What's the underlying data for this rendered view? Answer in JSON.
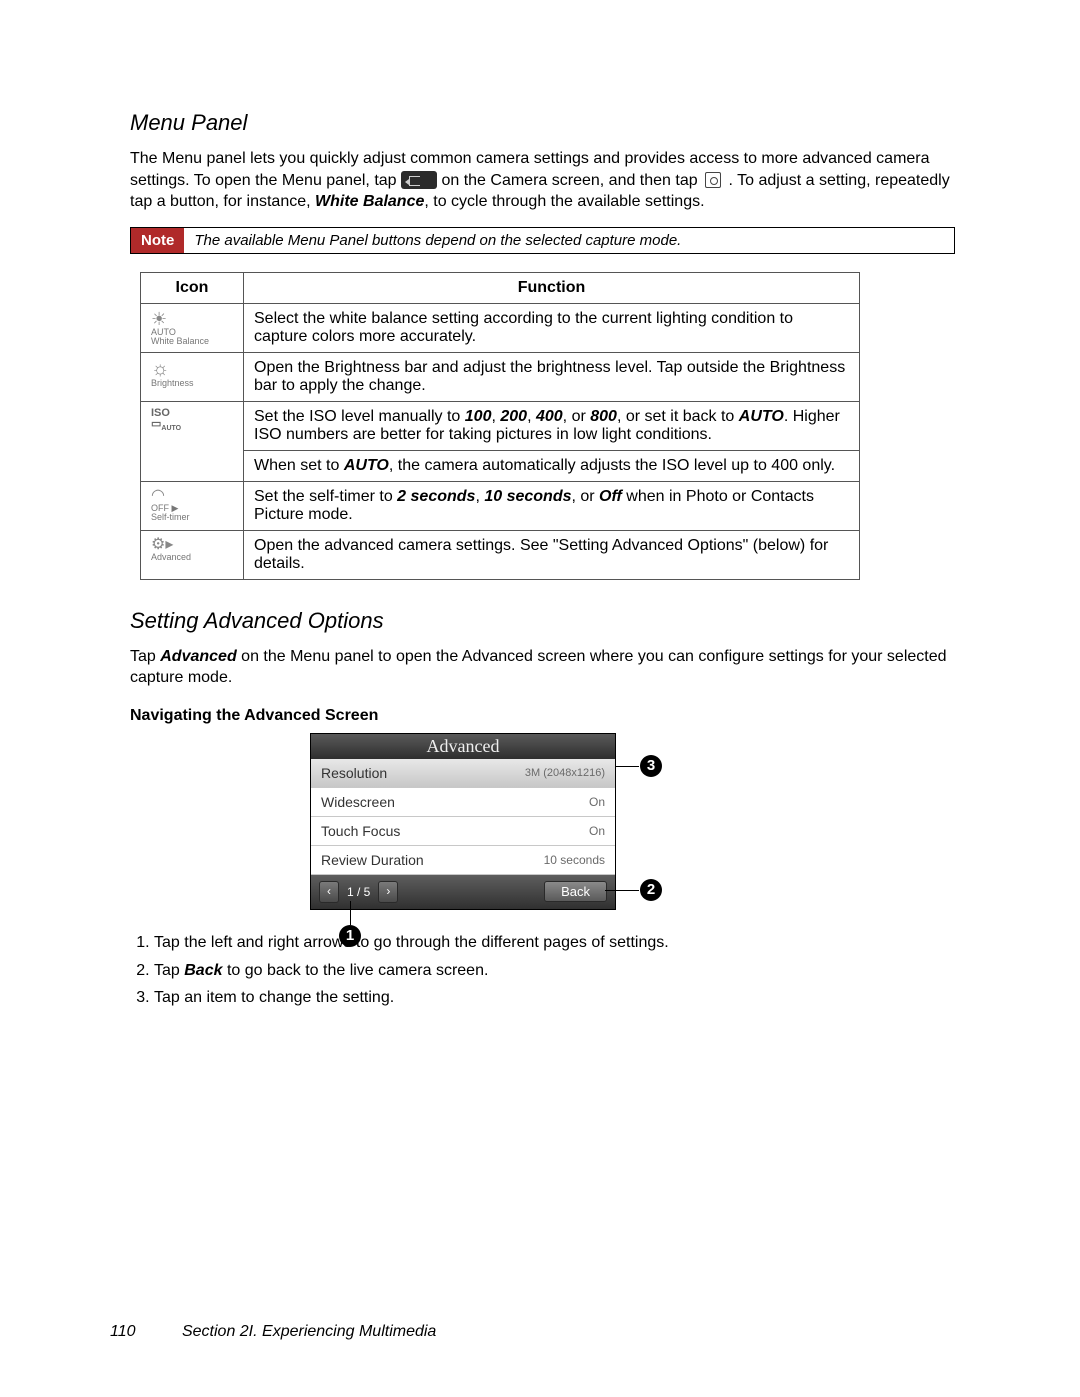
{
  "headings": {
    "menu_panel": "Menu Panel",
    "advanced": "Setting Advanced Options",
    "nav_sub": "Navigating the Advanced Screen"
  },
  "para": {
    "menu1a": "The Menu panel lets you quickly adjust common camera settings and provides access to more advanced camera settings. To open the Menu panel, tap ",
    "menu1b": " on the Camera screen, and then tap ",
    "menu1c": ". To adjust a setting, repeatedly tap a button, for instance, ",
    "menu1_wb": "White Balance",
    "menu1d": ", to cycle through the available settings.",
    "adv1a": "Tap ",
    "adv1_adv": "Advanced",
    "adv1b": " on the Menu panel to open the Advanced screen where you can configure settings for your selected capture mode."
  },
  "note": {
    "label": "Note",
    "text": "The available Menu Panel buttons depend on the selected capture mode."
  },
  "table": {
    "head_icon": "Icon",
    "head_func": "Function",
    "rows": [
      {
        "icon_label": "White Balance",
        "icon_sub": "AUTO",
        "func": "Select the white balance setting according to the current lighting condition to capture colors more accurately."
      },
      {
        "icon_label": "Brightness",
        "func": "Open the Brightness bar and adjust the brightness level. Tap outside the Brightness bar to apply the change."
      },
      {
        "icon_label": "ISO AUTO",
        "func_a": "Set the ISO level manually to ",
        "b1": "100",
        "c1": ", ",
        "b2": "200",
        "c2": ", ",
        "b3": "400",
        "c3": ", or ",
        "b4": "800",
        "c4": ", or set it back to ",
        "b5": "AUTO",
        "func_b": ". Higher ISO numbers are better for taking pictures in low light conditions.",
        "func_p2a": "When set to ",
        "func_p2b": ", the camera automatically adjusts the ISO level up to 400 only."
      },
      {
        "icon_label": "Self-timer",
        "icon_sub": "OFF",
        "func_a": "Set the self-timer to ",
        "b1": "2 seconds",
        "c1": ", ",
        "b2": "10 seconds",
        "c2": ", or ",
        "b3": "Off",
        "func_b": " when in Photo or Contacts Picture mode."
      },
      {
        "icon_label": "Advanced",
        "func": "Open the advanced camera settings. See \"Setting Advanced Options\" (below) for details."
      }
    ]
  },
  "screen": {
    "title": "Advanced",
    "rows": [
      {
        "label": "Resolution",
        "value": "3M (2048x1216)"
      },
      {
        "label": "Widescreen",
        "value": "On"
      },
      {
        "label": "Touch Focus",
        "value": "On"
      },
      {
        "label": "Review Duration",
        "value": "10 seconds"
      }
    ],
    "pager": {
      "prev": "‹",
      "text": "1 / 5",
      "next": "›"
    },
    "back": "Back"
  },
  "callouts": {
    "c1": "1",
    "c2": "2",
    "c3": "3"
  },
  "steps": [
    {
      "a": "Tap the left and right arrows to go through the different pages of settings."
    },
    {
      "a": "Tap ",
      "b": "Back",
      "c": " to go back to the live camera screen."
    },
    {
      "a": "Tap an item to change the setting."
    }
  ],
  "footer": {
    "page": "110",
    "section": "Section 2I. Experiencing Multimedia"
  }
}
